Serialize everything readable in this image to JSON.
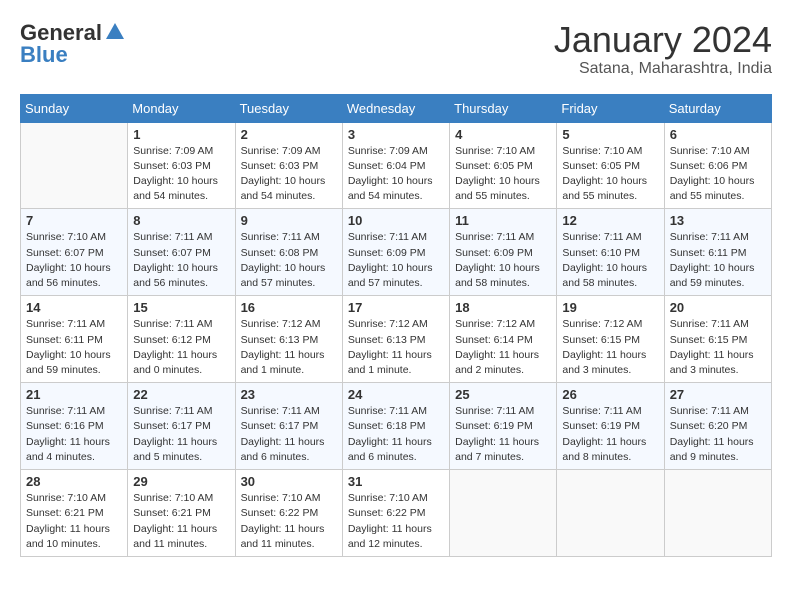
{
  "header": {
    "logo_general": "General",
    "logo_blue": "Blue",
    "month_title": "January 2024",
    "subtitle": "Satana, Maharashtra, India"
  },
  "days_of_week": [
    "Sunday",
    "Monday",
    "Tuesday",
    "Wednesday",
    "Thursday",
    "Friday",
    "Saturday"
  ],
  "weeks": [
    [
      {
        "day": "",
        "sunrise": "",
        "sunset": "",
        "daylight": ""
      },
      {
        "day": "1",
        "sunrise": "Sunrise: 7:09 AM",
        "sunset": "Sunset: 6:03 PM",
        "daylight": "Daylight: 10 hours and 54 minutes."
      },
      {
        "day": "2",
        "sunrise": "Sunrise: 7:09 AM",
        "sunset": "Sunset: 6:03 PM",
        "daylight": "Daylight: 10 hours and 54 minutes."
      },
      {
        "day": "3",
        "sunrise": "Sunrise: 7:09 AM",
        "sunset": "Sunset: 6:04 PM",
        "daylight": "Daylight: 10 hours and 54 minutes."
      },
      {
        "day": "4",
        "sunrise": "Sunrise: 7:10 AM",
        "sunset": "Sunset: 6:05 PM",
        "daylight": "Daylight: 10 hours and 55 minutes."
      },
      {
        "day": "5",
        "sunrise": "Sunrise: 7:10 AM",
        "sunset": "Sunset: 6:05 PM",
        "daylight": "Daylight: 10 hours and 55 minutes."
      },
      {
        "day": "6",
        "sunrise": "Sunrise: 7:10 AM",
        "sunset": "Sunset: 6:06 PM",
        "daylight": "Daylight: 10 hours and 55 minutes."
      }
    ],
    [
      {
        "day": "7",
        "sunrise": "Sunrise: 7:10 AM",
        "sunset": "Sunset: 6:07 PM",
        "daylight": "Daylight: 10 hours and 56 minutes."
      },
      {
        "day": "8",
        "sunrise": "Sunrise: 7:11 AM",
        "sunset": "Sunset: 6:07 PM",
        "daylight": "Daylight: 10 hours and 56 minutes."
      },
      {
        "day": "9",
        "sunrise": "Sunrise: 7:11 AM",
        "sunset": "Sunset: 6:08 PM",
        "daylight": "Daylight: 10 hours and 57 minutes."
      },
      {
        "day": "10",
        "sunrise": "Sunrise: 7:11 AM",
        "sunset": "Sunset: 6:09 PM",
        "daylight": "Daylight: 10 hours and 57 minutes."
      },
      {
        "day": "11",
        "sunrise": "Sunrise: 7:11 AM",
        "sunset": "Sunset: 6:09 PM",
        "daylight": "Daylight: 10 hours and 58 minutes."
      },
      {
        "day": "12",
        "sunrise": "Sunrise: 7:11 AM",
        "sunset": "Sunset: 6:10 PM",
        "daylight": "Daylight: 10 hours and 58 minutes."
      },
      {
        "day": "13",
        "sunrise": "Sunrise: 7:11 AM",
        "sunset": "Sunset: 6:11 PM",
        "daylight": "Daylight: 10 hours and 59 minutes."
      }
    ],
    [
      {
        "day": "14",
        "sunrise": "Sunrise: 7:11 AM",
        "sunset": "Sunset: 6:11 PM",
        "daylight": "Daylight: 10 hours and 59 minutes."
      },
      {
        "day": "15",
        "sunrise": "Sunrise: 7:11 AM",
        "sunset": "Sunset: 6:12 PM",
        "daylight": "Daylight: 11 hours and 0 minutes."
      },
      {
        "day": "16",
        "sunrise": "Sunrise: 7:12 AM",
        "sunset": "Sunset: 6:13 PM",
        "daylight": "Daylight: 11 hours and 1 minute."
      },
      {
        "day": "17",
        "sunrise": "Sunrise: 7:12 AM",
        "sunset": "Sunset: 6:13 PM",
        "daylight": "Daylight: 11 hours and 1 minute."
      },
      {
        "day": "18",
        "sunrise": "Sunrise: 7:12 AM",
        "sunset": "Sunset: 6:14 PM",
        "daylight": "Daylight: 11 hours and 2 minutes."
      },
      {
        "day": "19",
        "sunrise": "Sunrise: 7:12 AM",
        "sunset": "Sunset: 6:15 PM",
        "daylight": "Daylight: 11 hours and 3 minutes."
      },
      {
        "day": "20",
        "sunrise": "Sunrise: 7:11 AM",
        "sunset": "Sunset: 6:15 PM",
        "daylight": "Daylight: 11 hours and 3 minutes."
      }
    ],
    [
      {
        "day": "21",
        "sunrise": "Sunrise: 7:11 AM",
        "sunset": "Sunset: 6:16 PM",
        "daylight": "Daylight: 11 hours and 4 minutes."
      },
      {
        "day": "22",
        "sunrise": "Sunrise: 7:11 AM",
        "sunset": "Sunset: 6:17 PM",
        "daylight": "Daylight: 11 hours and 5 minutes."
      },
      {
        "day": "23",
        "sunrise": "Sunrise: 7:11 AM",
        "sunset": "Sunset: 6:17 PM",
        "daylight": "Daylight: 11 hours and 6 minutes."
      },
      {
        "day": "24",
        "sunrise": "Sunrise: 7:11 AM",
        "sunset": "Sunset: 6:18 PM",
        "daylight": "Daylight: 11 hours and 6 minutes."
      },
      {
        "day": "25",
        "sunrise": "Sunrise: 7:11 AM",
        "sunset": "Sunset: 6:19 PM",
        "daylight": "Daylight: 11 hours and 7 minutes."
      },
      {
        "day": "26",
        "sunrise": "Sunrise: 7:11 AM",
        "sunset": "Sunset: 6:19 PM",
        "daylight": "Daylight: 11 hours and 8 minutes."
      },
      {
        "day": "27",
        "sunrise": "Sunrise: 7:11 AM",
        "sunset": "Sunset: 6:20 PM",
        "daylight": "Daylight: 11 hours and 9 minutes."
      }
    ],
    [
      {
        "day": "28",
        "sunrise": "Sunrise: 7:10 AM",
        "sunset": "Sunset: 6:21 PM",
        "daylight": "Daylight: 11 hours and 10 minutes."
      },
      {
        "day": "29",
        "sunrise": "Sunrise: 7:10 AM",
        "sunset": "Sunset: 6:21 PM",
        "daylight": "Daylight: 11 hours and 11 minutes."
      },
      {
        "day": "30",
        "sunrise": "Sunrise: 7:10 AM",
        "sunset": "Sunset: 6:22 PM",
        "daylight": "Daylight: 11 hours and 11 minutes."
      },
      {
        "day": "31",
        "sunrise": "Sunrise: 7:10 AM",
        "sunset": "Sunset: 6:22 PM",
        "daylight": "Daylight: 11 hours and 12 minutes."
      },
      {
        "day": "",
        "sunrise": "",
        "sunset": "",
        "daylight": ""
      },
      {
        "day": "",
        "sunrise": "",
        "sunset": "",
        "daylight": ""
      },
      {
        "day": "",
        "sunrise": "",
        "sunset": "",
        "daylight": ""
      }
    ]
  ]
}
